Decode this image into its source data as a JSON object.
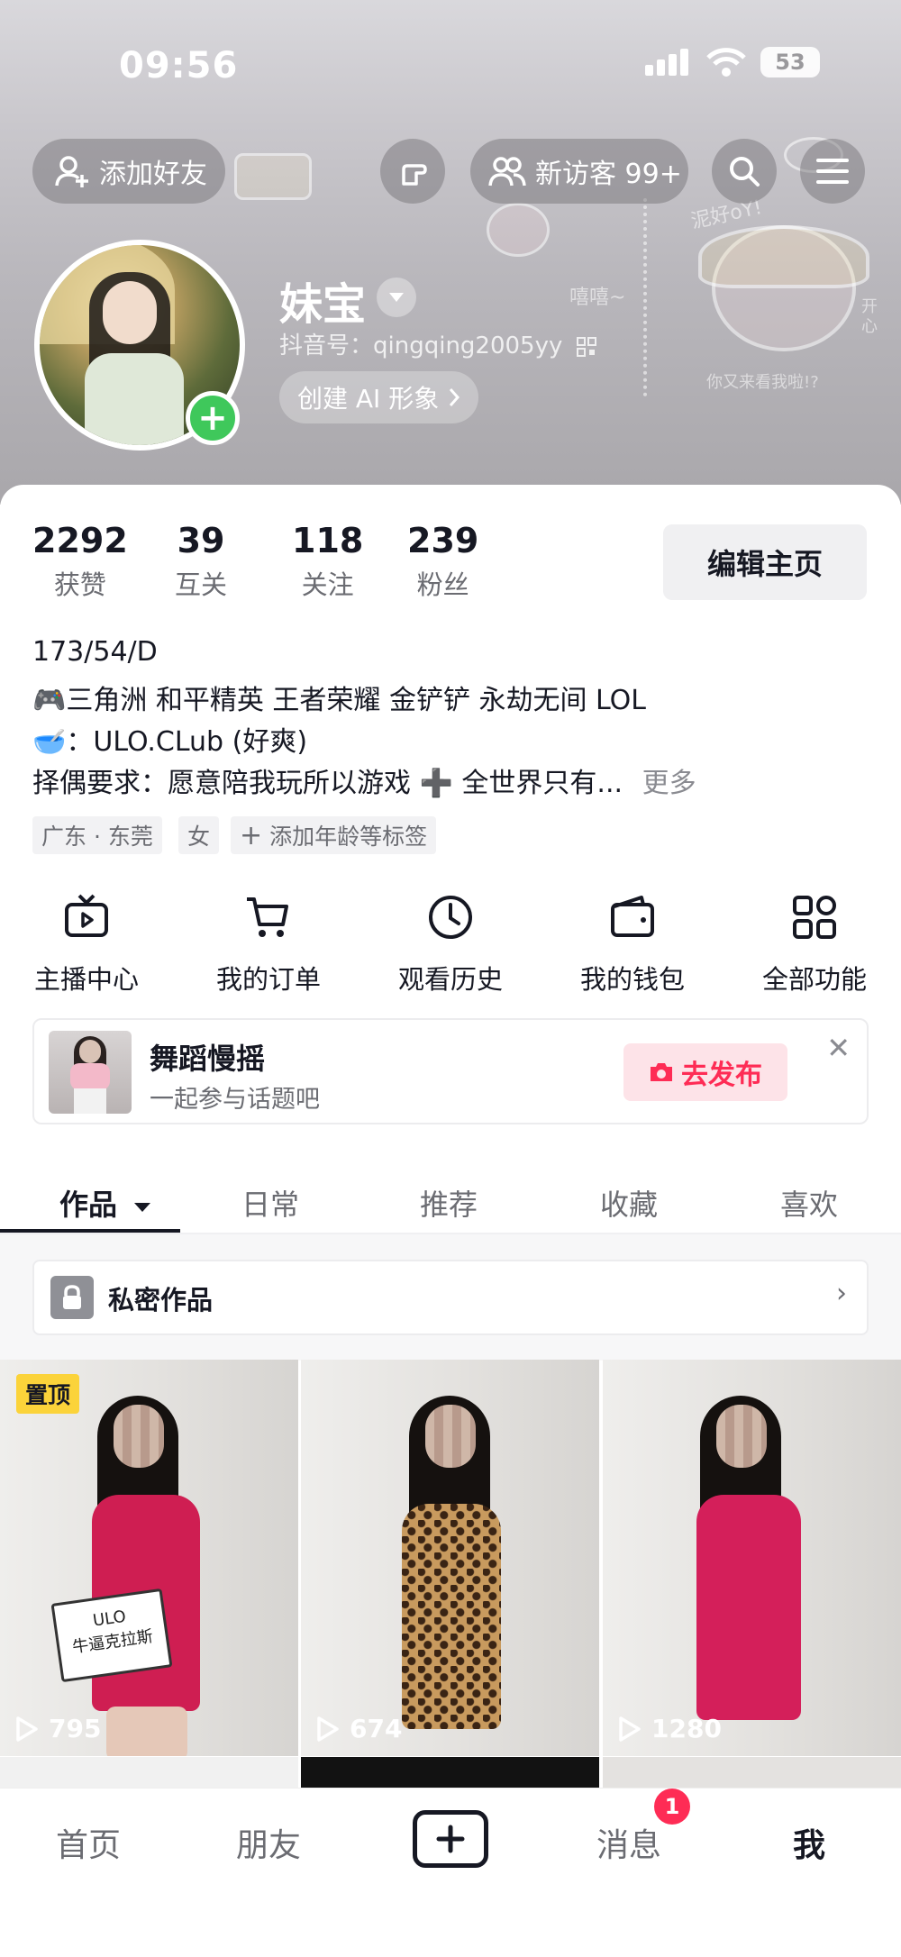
{
  "status_bar": {
    "time": "09:56",
    "battery": "53"
  },
  "header": {
    "add_friend": "添加好友",
    "new_visitors": "新访客 99+",
    "nickname": "妹宝",
    "douyin_id": "抖音号：qingqing2005yy",
    "create_ai": "创建 AI 形象",
    "sticker_texts": [
      "泥好oY!",
      "你又来看我啦!?",
      "嘻嘻~",
      "开心"
    ]
  },
  "stats": [
    {
      "value": "2292",
      "label": "获赞"
    },
    {
      "value": "39",
      "label": "互关"
    },
    {
      "value": "118",
      "label": "关注"
    },
    {
      "value": "239",
      "label": "粉丝"
    }
  ],
  "edit_profile": "编辑主页",
  "bio": {
    "line1": "173/54/D",
    "line2_emoji": "🎮",
    "line2": "三角洲 和平精英 王者荣耀 金铲铲 永劫无间 LOL",
    "line3_emoji": "🥣",
    "line3": "：ULO.CLub (好爽)",
    "line4": "择偶要求：愿意陪我玩所以游戏 ➕ 全世界只有...",
    "more": "更多"
  },
  "tags": [
    "广东 · 东莞",
    "女",
    "添加年龄等标签"
  ],
  "shortcuts": [
    {
      "label": "主播中心",
      "icon": "tv-play-icon"
    },
    {
      "label": "我的订单",
      "icon": "cart-icon"
    },
    {
      "label": "观看历史",
      "icon": "clock-icon"
    },
    {
      "label": "我的钱包",
      "icon": "wallet-icon"
    },
    {
      "label": "全部功能",
      "icon": "grid-apps-icon"
    }
  ],
  "promo": {
    "title": "舞蹈慢摇",
    "subtitle": "一起参与话题吧",
    "button": "去发布"
  },
  "tabs": [
    "作品",
    "日常",
    "推荐",
    "收藏",
    "喜欢"
  ],
  "private_works": "私密作品",
  "videos": [
    {
      "views": "795",
      "pinned": "置顶",
      "sign_line1": "ULO",
      "sign_line2": "牛逼克拉斯"
    },
    {
      "views": "674"
    },
    {
      "views": "1280"
    }
  ],
  "bottom_nav": {
    "home": "首页",
    "friends": "朋友",
    "messages": "消息",
    "me": "我",
    "message_badge": "1"
  },
  "colors": {
    "accent_red": "#fe2c55",
    "plus_green": "#3fc85b",
    "pin_yellow": "#fbd33a"
  }
}
